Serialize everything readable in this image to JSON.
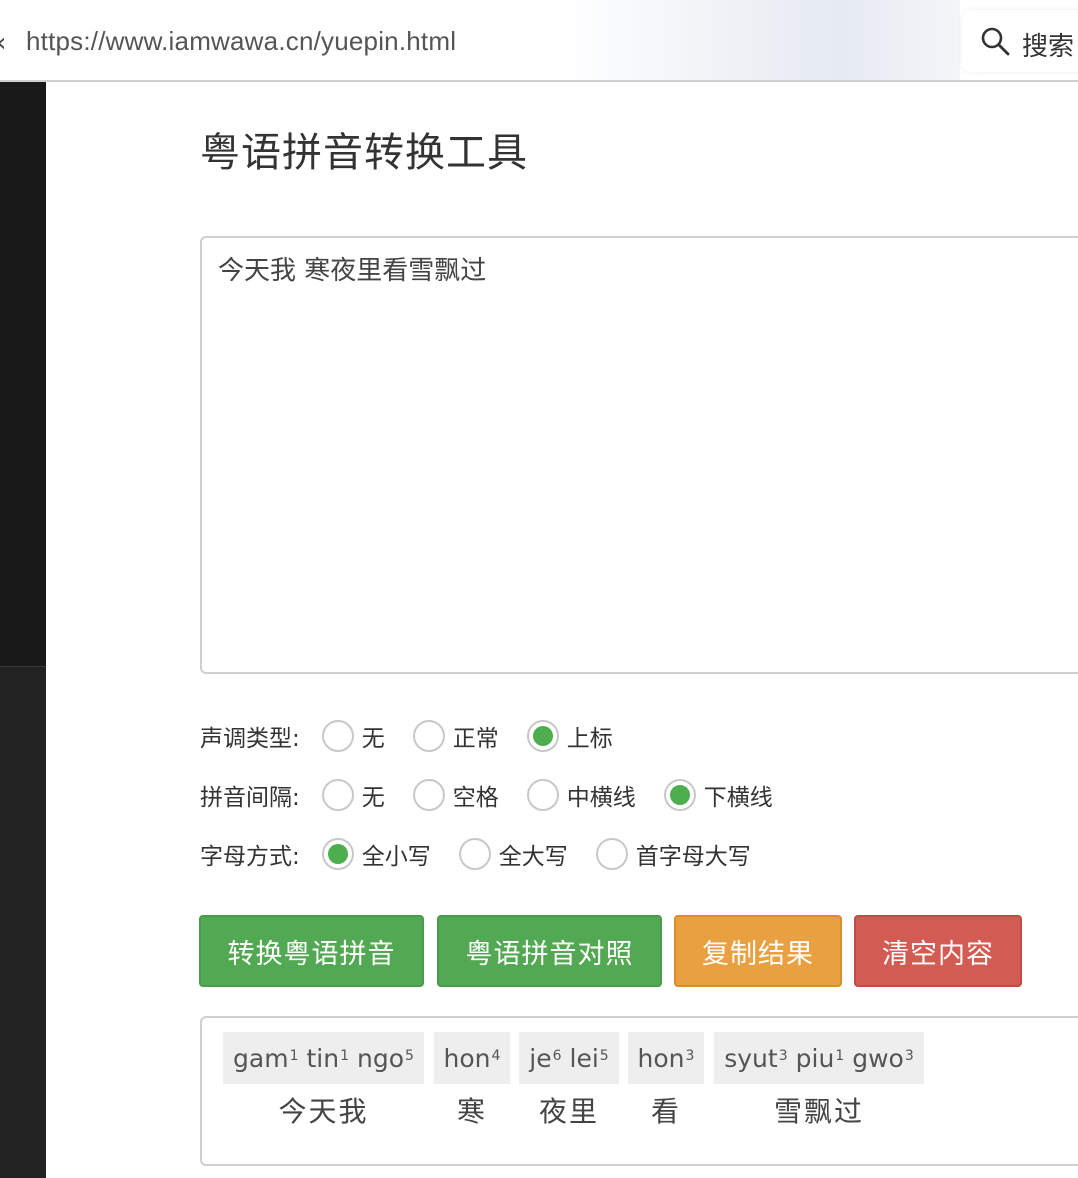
{
  "browser": {
    "url": "https://www.iamwawa.cn/yuepin.html",
    "search_label": "搜索"
  },
  "page": {
    "title": "粤语拼音转换工具"
  },
  "input": {
    "value": "今天我 寒夜里看雪飘过"
  },
  "options": {
    "tone": {
      "label": "声调类型:",
      "choices": [
        "无",
        "正常",
        "上标"
      ],
      "selected": "上标"
    },
    "spacing": {
      "label": "拼音间隔:",
      "choices": [
        "无",
        "空格",
        "中横线",
        "下横线"
      ],
      "selected": "下横线"
    },
    "letter_case": {
      "label": "字母方式:",
      "choices": [
        "全小写",
        "全大写",
        "首字母大写"
      ],
      "selected": "全小写"
    }
  },
  "buttons": {
    "convert": "转换粤语拼音",
    "compare": "粤语拼音对照",
    "copy": "复制结果",
    "clear": "清空内容"
  },
  "colors": {
    "green": "#53a853",
    "orange": "#e9a040",
    "red": "#d25b53"
  },
  "result": {
    "segments": [
      {
        "syllables": [
          {
            "s": "gam",
            "t": "1"
          },
          {
            "s": "tin",
            "t": "1"
          },
          {
            "s": "ngo",
            "t": "5"
          }
        ],
        "text": "今天我"
      },
      {
        "syllables": [
          {
            "s": "hon",
            "t": "4"
          }
        ],
        "text": "寒"
      },
      {
        "syllables": [
          {
            "s": "je",
            "t": "6"
          },
          {
            "s": "lei",
            "t": "5"
          }
        ],
        "text": "夜里"
      },
      {
        "syllables": [
          {
            "s": "hon",
            "t": "3"
          }
        ],
        "text": "看"
      },
      {
        "syllables": [
          {
            "s": "syut",
            "t": "3"
          },
          {
            "s": "piu",
            "t": "1"
          },
          {
            "s": "gwo",
            "t": "3"
          }
        ],
        "text": "雪飘过"
      }
    ]
  }
}
